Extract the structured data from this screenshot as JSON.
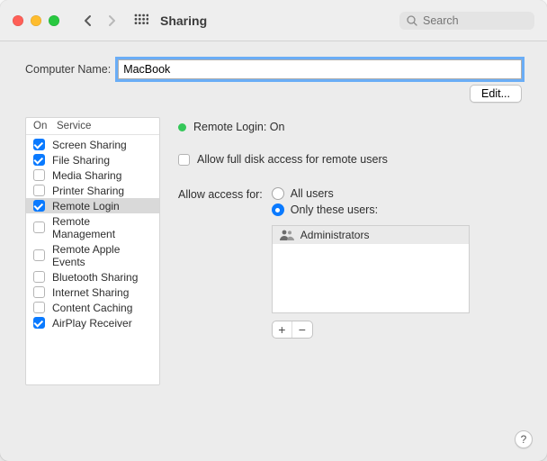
{
  "window": {
    "title": "Sharing",
    "search_placeholder": "Search"
  },
  "computer_name": {
    "label": "Computer Name:",
    "value": "MacBook",
    "edit_button": "Edit..."
  },
  "services": {
    "header_on": "On",
    "header_service": "Service",
    "items": [
      {
        "label": "Screen Sharing",
        "checked": true,
        "selected": false
      },
      {
        "label": "File Sharing",
        "checked": true,
        "selected": false
      },
      {
        "label": "Media Sharing",
        "checked": false,
        "selected": false
      },
      {
        "label": "Printer Sharing",
        "checked": false,
        "selected": false
      },
      {
        "label": "Remote Login",
        "checked": true,
        "selected": true
      },
      {
        "label": "Remote Management",
        "checked": false,
        "selected": false
      },
      {
        "label": "Remote Apple Events",
        "checked": false,
        "selected": false
      },
      {
        "label": "Bluetooth Sharing",
        "checked": false,
        "selected": false
      },
      {
        "label": "Internet Sharing",
        "checked": false,
        "selected": false
      },
      {
        "label": "Content Caching",
        "checked": false,
        "selected": false
      },
      {
        "label": "AirPlay Receiver",
        "checked": true,
        "selected": false
      }
    ]
  },
  "detail": {
    "status_label": "Remote Login: On",
    "status_color": "#34c759",
    "allow_full_disk_label": "Allow full disk access for remote users",
    "allow_full_disk_checked": false,
    "access_label": "Allow access for:",
    "access_options": {
      "all": {
        "label": "All users",
        "checked": false
      },
      "only": {
        "label": "Only these users:",
        "checked": true
      }
    },
    "users": [
      {
        "label": "Administrators"
      }
    ],
    "add_label": "+",
    "remove_label": "−"
  },
  "help_label": "?"
}
